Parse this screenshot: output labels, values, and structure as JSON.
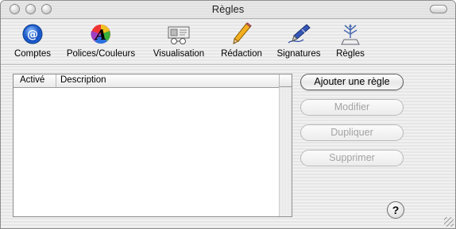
{
  "window": {
    "title": "Règles"
  },
  "toolbar": {
    "items": [
      {
        "label": "Comptes",
        "icon": "at-sign-icon"
      },
      {
        "label": "Polices/Couleurs",
        "icon": "font-color-wheel-icon"
      },
      {
        "label": "Visualisation",
        "icon": "viewer-icon"
      },
      {
        "label": "Rédaction",
        "icon": "pencil-icon"
      },
      {
        "label": "Signatures",
        "icon": "fountain-pen-icon"
      },
      {
        "label": "Règles",
        "icon": "rules-icon"
      }
    ]
  },
  "table": {
    "columns": [
      "Activé",
      "Description"
    ],
    "rows": []
  },
  "buttons": {
    "add": "Ajouter une règle",
    "edit": "Modifier",
    "duplicate": "Dupliquer",
    "delete": "Supprimer"
  },
  "help": {
    "label": "?"
  }
}
